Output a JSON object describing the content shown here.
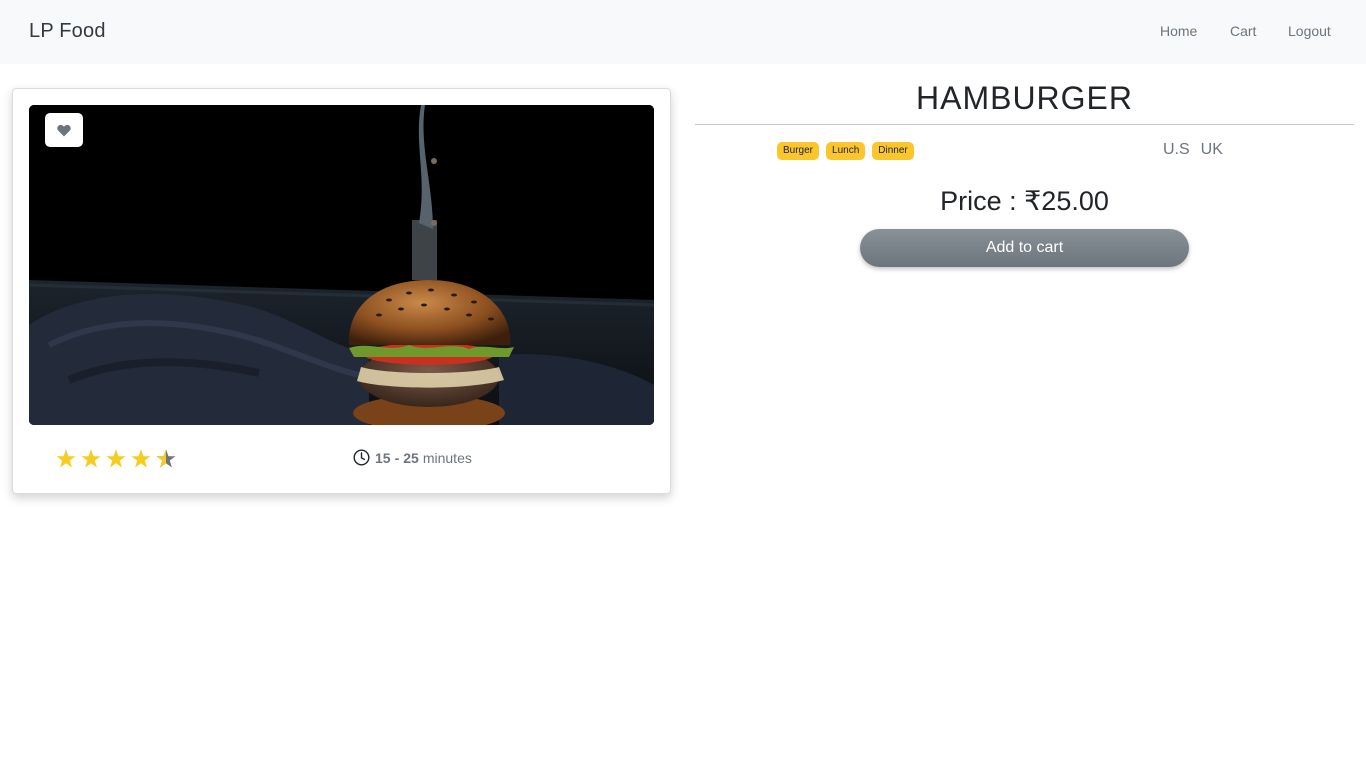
{
  "navbar": {
    "brand": "LP Food",
    "links": [
      "Home",
      "Cart",
      "Logout"
    ]
  },
  "food": {
    "name": "HAMBURGER",
    "image_description": "burger-photo",
    "favorite_icon": "heart-icon",
    "rating": 4.5,
    "rating_max": 5,
    "cook_time": {
      "min": "15",
      "separator": "-",
      "max": "25",
      "unit": "minutes"
    },
    "tags": [
      "Burger",
      "Lunch",
      "Dinner"
    ],
    "origins": [
      "U.S",
      "UK"
    ],
    "price_text": "Price : ₹25.00",
    "add_to_cart_label": "Add to cart"
  },
  "colors": {
    "navbar_bg": "#f8f9fa",
    "star": "#f5cd1e",
    "star_empty": "#6c757d",
    "tag_bg": "#fbc62b",
    "button_bg": "#6c757d"
  }
}
